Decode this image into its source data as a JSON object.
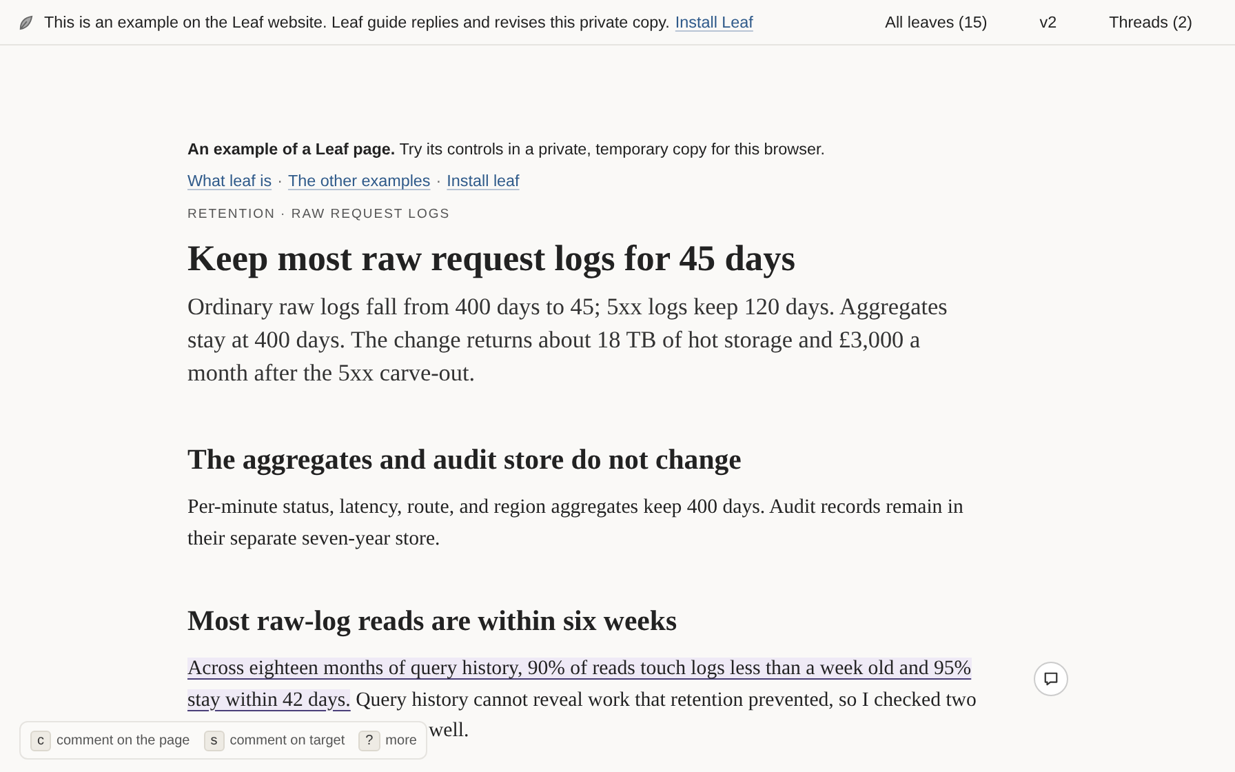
{
  "top_bar": {
    "notice": "This is an example on the Leaf website. Leaf guide replies and revises this private copy.",
    "install_link": "Install Leaf",
    "nav": [
      {
        "label": "All leaves (15)"
      },
      {
        "label": "v2"
      },
      {
        "label": "Threads (2)"
      }
    ]
  },
  "intro": {
    "lead": "An example of a Leaf page.",
    "text": "Try its controls in a private, temporary copy for this browser."
  },
  "links": [
    "What leaf is",
    "The other examples",
    "Install leaf"
  ],
  "link_separator": "·",
  "kicker": "RETENTION · RAW REQUEST LOGS",
  "title": "Keep most raw request logs for 45 days",
  "summary": "Ordinary raw logs fall from 400 days to 45; 5xx logs keep 120 days. Aggregates stay at 400 days. The change returns about 18 TB of hot storage and £3,000 a month after the 5xx carve-out.",
  "sections": [
    {
      "heading": "The aggregates and audit store do not change",
      "text": "Per-minute status, latency, route, and region aggregates keep 400 days. Audit records remain in their separate seven-year store."
    },
    {
      "heading": "Most raw-log reads are within six weeks",
      "highlight": "Across eighteen months of query history, 90% of reads touch logs less than a week old and 95% stay within 42 days.",
      "text": "Query history cannot reveal work that retention prevented, so I checked two",
      "tail": "well."
    }
  ],
  "shortcuts": [
    {
      "key": "c",
      "label": "comment on the page"
    },
    {
      "key": "s",
      "label": "comment on target"
    },
    {
      "key": "?",
      "label": "more"
    }
  ]
}
